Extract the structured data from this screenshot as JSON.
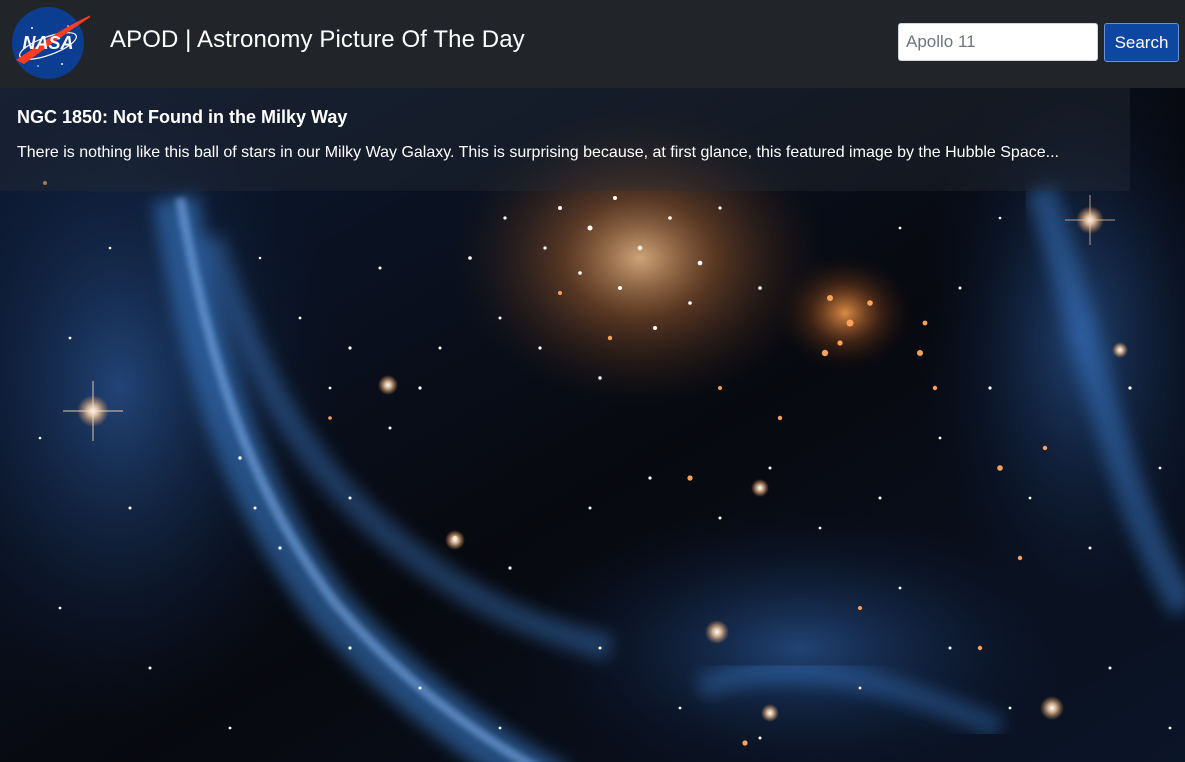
{
  "header": {
    "logo_text": "NASA",
    "title": "APOD | Astronomy Picture Of The Day"
  },
  "search": {
    "value": "Apollo 11",
    "placeholder": "Apollo 11",
    "button_label": "Search"
  },
  "apod": {
    "title": "NGC 1850: Not Found in the Milky Way",
    "explanation": "There is nothing like this ball of stars in our Milky Way Galaxy. This is surprising because, at first glance, this featured image by the Hubble Space..."
  },
  "colors": {
    "navbar": "#212529",
    "button": "#0d47a1",
    "nebula_blue": "#2d6ab8",
    "star_orange": "#e8843a"
  }
}
